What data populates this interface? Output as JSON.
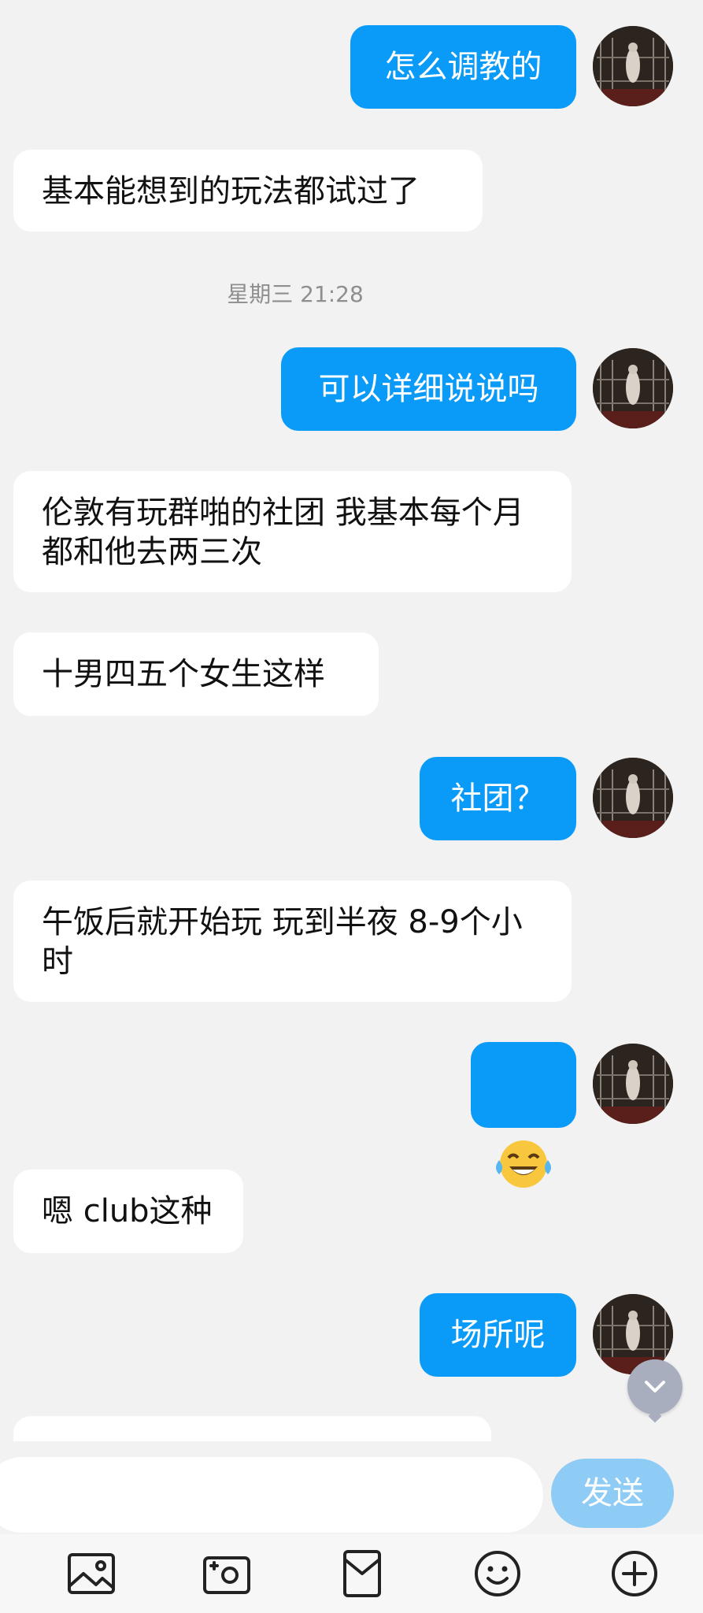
{
  "messages": [
    {
      "from": "me",
      "text": "怎么调教的"
    },
    {
      "from": "other",
      "text": "基本能想到的玩法都试过了"
    },
    {
      "type": "time",
      "text": "星期三 21:28"
    },
    {
      "from": "me",
      "text": "可以详细说说吗"
    },
    {
      "from": "other",
      "text": "伦敦有玩群啪的社团 我基本每个月都和他去两三次"
    },
    {
      "from": "other",
      "text": "十男四五个女生这样"
    },
    {
      "from": "me",
      "text": "社团？"
    },
    {
      "from": "other",
      "text": "午饭后就开始玩 玩到半夜 8-9个小时"
    },
    {
      "from": "me",
      "emoji": "tears-of-joy-emoji"
    },
    {
      "from": "other",
      "text": "嗯 club这种"
    },
    {
      "from": "me",
      "text": "场所呢"
    }
  ],
  "input": {
    "placeholder": "",
    "value": "",
    "send_label": "发送"
  },
  "toolbar": {
    "icons": [
      "image-icon",
      "camera-icon",
      "red-envelope-icon",
      "emoji-icon",
      "plus-icon"
    ]
  },
  "colors": {
    "outgoing_bubble": "#0a9af7",
    "incoming_bubble": "#ffffff",
    "send_button": "#8ecbf5",
    "background": "#f2f2f2"
  }
}
